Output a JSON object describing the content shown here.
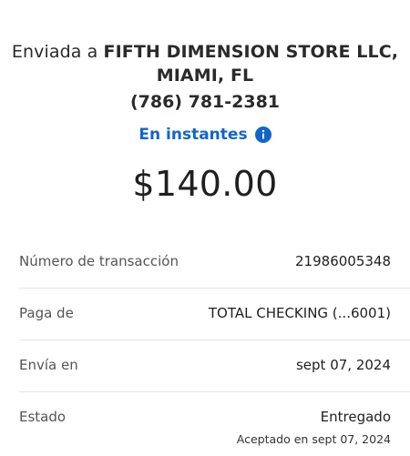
{
  "recipient": {
    "prefix": "Enviada a",
    "name_line1": "FIFTH DIMENSION STORE LLC,",
    "name_line2": "MIAMI, FL",
    "phone": "(786) 781-2381"
  },
  "delivery": {
    "speed": "En instantes",
    "info_icon": "info-icon"
  },
  "amount": "$140.00",
  "details": [
    {
      "label": "Número de transacción",
      "value": "21986005348"
    },
    {
      "label": "Paga de",
      "value": "TOTAL CHECKING (...6001)"
    },
    {
      "label": "Envía en",
      "value": "sept 07, 2024"
    },
    {
      "label": "Estado",
      "value": "Entregado",
      "sub": "Aceptado en sept 07, 2024"
    }
  ],
  "colors": {
    "accent": "#1166c9",
    "divider": "#e5e5e5"
  }
}
